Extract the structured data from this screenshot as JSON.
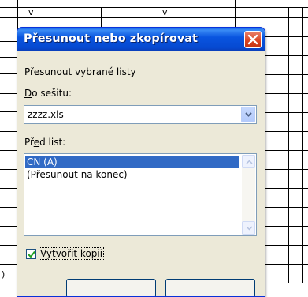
{
  "sheet": {
    "column_headers": [
      "v",
      "v"
    ],
    "peek_char": ")"
  },
  "dialog": {
    "title": "Přesunout nebo zkopírovat",
    "instruction": "Přesunout vybrané listy",
    "to_book_label_prefix": "",
    "to_book_label_accel": "D",
    "to_book_label_rest": "o sešitu:",
    "to_book_value": "zzzz.xls",
    "before_sheet_label_prefix": "Př",
    "before_sheet_label_accel": "e",
    "before_sheet_label_rest": "d list:",
    "sheets": [
      "CN (A)",
      "(Přesunout na konec)"
    ],
    "selected_index": 0,
    "copy_label_prefix": "",
    "copy_label_accel": "V",
    "copy_label_rest": "ytvořit kopii",
    "copy_checked": true
  }
}
